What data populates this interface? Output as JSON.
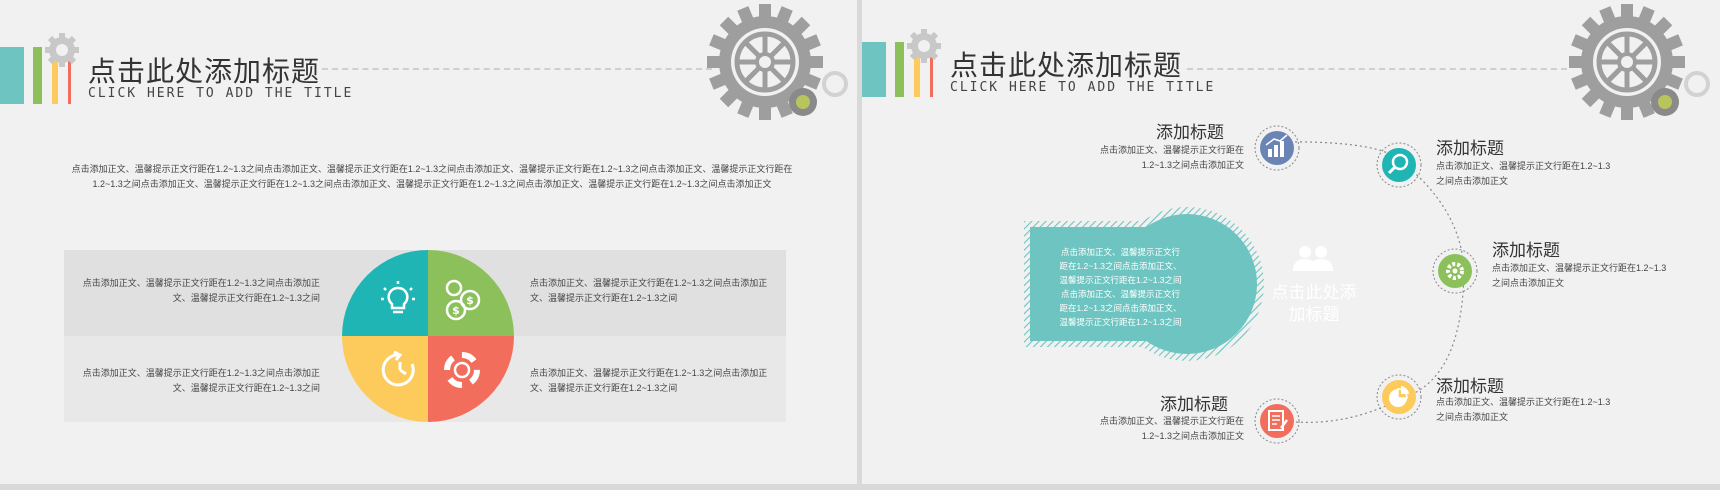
{
  "slide1": {
    "title": "点击此处添加标题",
    "subtitle": "CLICK HERE TO ADD THE TITLE",
    "body": "点击添加正文、温馨提示正文行距在1.2~1.3之间点击添加正文、温馨提示正文行距在1.2~1.3之间点击添加正文、温馨提示正文行距在1.2~1.3之间点击添加正文、温馨提示正文行距在1.2~1.3之间点击添加正文、温馨提示正文行距在1.2~1.3之间点击添加正文、温馨提示正文行距在1.2~1.3之间点击添加正文、温馨提示正文行距在1.2~1.3之间点击添加正文",
    "cells": [
      "点击添加正文、温馨提示正文行距在1.2~1.3之间点击添加正文、温馨提示正文行距在1.2~1.3之间",
      "点击添加正文、温馨提示正文行距在1.2~1.3之间点击添加正文、温馨提示正文行距在1.2~1.3之间",
      "点击添加正文、温馨提示正文行距在1.2~1.3之间点击添加正文、温馨提示正文行距在1.2~1.3之间",
      "点击添加正文、温馨提示正文行距在1.2~1.3之间点击添加正文、温馨提示正文行距在1.2~1.3之间"
    ],
    "quadrant_icons": [
      "lightbulb-icon",
      "coins-icon",
      "cycle-icon",
      "lifebuoy-icon"
    ],
    "colors": {
      "teal": "#1fb5b5",
      "green": "#8cc05b",
      "yellow": "#fccb5b",
      "red": "#f36d5d"
    }
  },
  "slide2": {
    "title": "点击此处添加标题",
    "subtitle": "CLICK HERE TO ADD THE TITLE",
    "center_title": "点击此处添加标题",
    "center_body": "点击添加正文、温馨提示正文行距在1.2~1.3之间点击添加正文、温馨提示正文行距在1.2~1.3之间点击添加正文、温馨提示正文行距在1.2~1.3之间点击添加正文、温馨提示正文行距在1.2~1.3之间",
    "nodes": [
      {
        "title": "添加标题",
        "desc": "点击添加正文、温馨提示正文行距在1.2~1.3之间点击添加正文",
        "icon": "bar-chart-icon"
      },
      {
        "title": "添加标题",
        "desc": "点击添加正文、温馨提示正文行距在1.2~1.3之间点击添加正文",
        "icon": "search-icon"
      },
      {
        "title": "添加标题",
        "desc": "点击添加正文、温馨提示正文行距在1.2~1.3之间点击添加正文",
        "icon": "gear-icon"
      },
      {
        "title": "添加标题",
        "desc": "点击添加正文、温馨提示正文行距在1.2~1.3之间点击添加正文",
        "icon": "pie-chart-icon"
      },
      {
        "title": "添加标题",
        "desc": "点击添加正文、温馨提示正文行距在1.2~1.3之间点击添加正文",
        "icon": "document-icon"
      }
    ],
    "colors": {
      "teal": "#6ec4c0",
      "blue": "#6a85b5",
      "green": "#8cc05b",
      "yellow": "#fccb5b",
      "red": "#f36d5d"
    }
  }
}
